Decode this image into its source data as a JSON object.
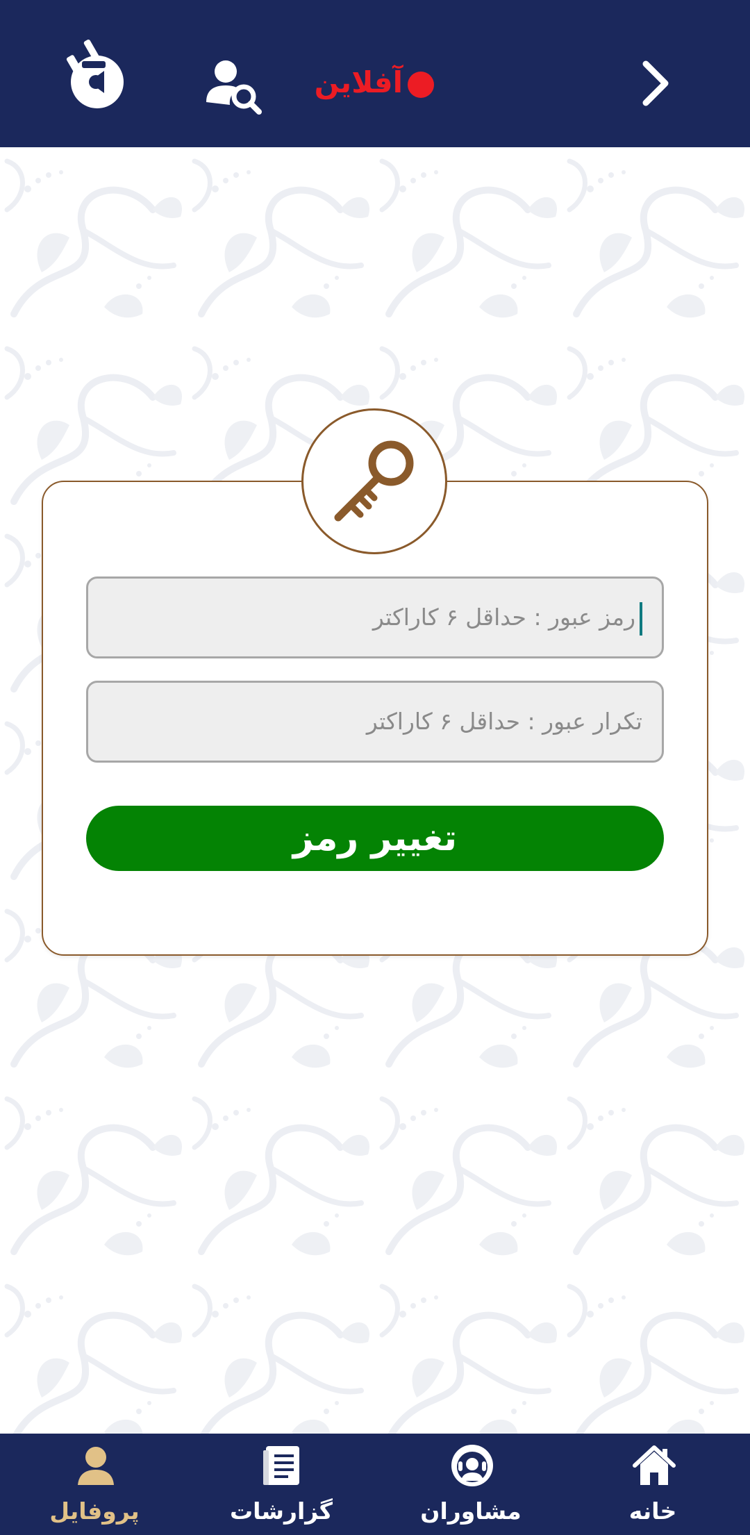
{
  "header": {
    "status_text": "آفلاین",
    "colors": {
      "bar": "#1b285c",
      "status": "#ec1c24"
    },
    "icons": {
      "back": "chevron-right-icon",
      "search_user": "user-search-icon",
      "logo": "app-logo"
    }
  },
  "form": {
    "password_placeholder": "رمز عبور : حداقل ۶ کاراکتر",
    "confirm_placeholder": "تکرار عبور : حداقل ۶ کاراکتر",
    "submit_label": "تغییر رمز",
    "icon": "key-icon",
    "colors": {
      "border": "#8a5a2b",
      "submit": "#048304"
    }
  },
  "bottom_nav": {
    "items": [
      {
        "label": "پروفایل",
        "icon": "user-icon",
        "active": true
      },
      {
        "label": "گزارشات",
        "icon": "document-list-icon",
        "active": false
      },
      {
        "label": "مشاوران",
        "icon": "headset-user-icon",
        "active": false
      },
      {
        "label": "خانه",
        "icon": "home-icon",
        "active": false
      }
    ],
    "colors": {
      "bar": "#1b285c",
      "active": "#e1c187",
      "inactive": "#ffffff"
    }
  }
}
